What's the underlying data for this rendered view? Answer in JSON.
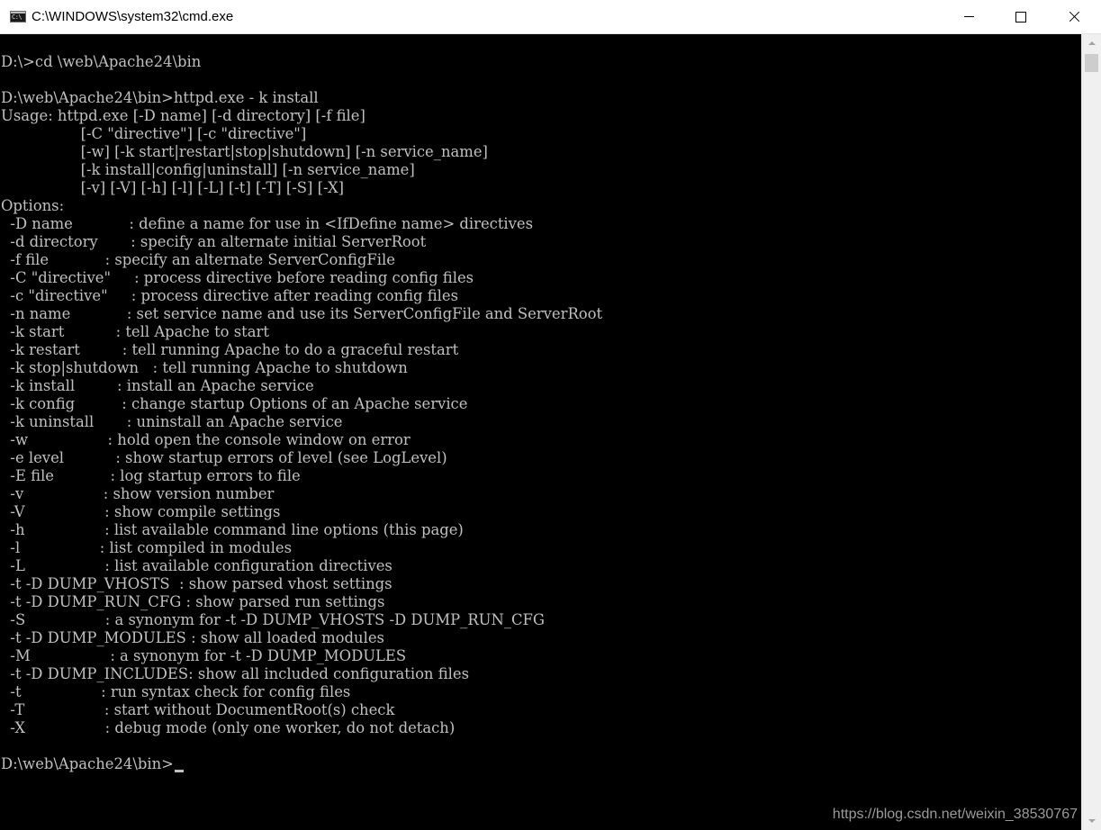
{
  "window": {
    "title": "C:\\WINDOWS\\system32\\cmd.exe",
    "icon_text": "C:\\"
  },
  "console": {
    "lines": [
      "D:\\>cd \\web\\Apache24\\bin",
      "",
      "D:\\web\\Apache24\\bin>httpd.exe - k install",
      "Usage: httpd.exe [-D name] [-d directory] [-f file]",
      "                 [-C \"directive\"] [-c \"directive\"]",
      "                 [-w] [-k start|restart|stop|shutdown] [-n service_name]",
      "                 [-k install|config|uninstall] [-n service_name]",
      "                 [-v] [-V] [-h] [-l] [-L] [-t] [-T] [-S] [-X]",
      "Options:",
      "  -D name            : define a name for use in <IfDefine name> directives",
      "  -d directory       : specify an alternate initial ServerRoot",
      "  -f file            : specify an alternate ServerConfigFile",
      "  -C \"directive\"     : process directive before reading config files",
      "  -c \"directive\"     : process directive after reading config files",
      "  -n name            : set service name and use its ServerConfigFile and ServerRoot",
      "  -k start           : tell Apache to start",
      "  -k restart         : tell running Apache to do a graceful restart",
      "  -k stop|shutdown   : tell running Apache to shutdown",
      "  -k install         : install an Apache service",
      "  -k config          : change startup Options of an Apache service",
      "  -k uninstall       : uninstall an Apache service",
      "  -w                 : hold open the console window on error",
      "  -e level           : show startup errors of level (see LogLevel)",
      "  -E file            : log startup errors to file",
      "  -v                 : show version number",
      "  -V                 : show compile settings",
      "  -h                 : list available command line options (this page)",
      "  -l                 : list compiled in modules",
      "  -L                 : list available configuration directives",
      "  -t -D DUMP_VHOSTS  : show parsed vhost settings",
      "  -t -D DUMP_RUN_CFG : show parsed run settings",
      "  -S                 : a synonym for -t -D DUMP_VHOSTS -D DUMP_RUN_CFG",
      "  -t -D DUMP_MODULES : show all loaded modules",
      "  -M                 : a synonym for -t -D DUMP_MODULES",
      "  -t -D DUMP_INCLUDES: show all included configuration files",
      "  -t                 : run syntax check for config files",
      "  -T                 : start without DocumentRoot(s) check",
      "  -X                 : debug mode (only one worker, do not detach)",
      ""
    ],
    "prompt": "D:\\web\\Apache24\\bin>"
  },
  "watermark": "https://blog.csdn.net/weixin_38530767",
  "colors": {
    "console_bg": "#000000",
    "console_fg": "#c0c0c0",
    "titlebar_bg": "#ffffff",
    "scrollbar_bg": "#f0f0f0"
  },
  "icons": {
    "app": "cmd-icon",
    "minimize": "minimize-icon",
    "maximize": "maximize-icon",
    "close": "close-icon"
  }
}
